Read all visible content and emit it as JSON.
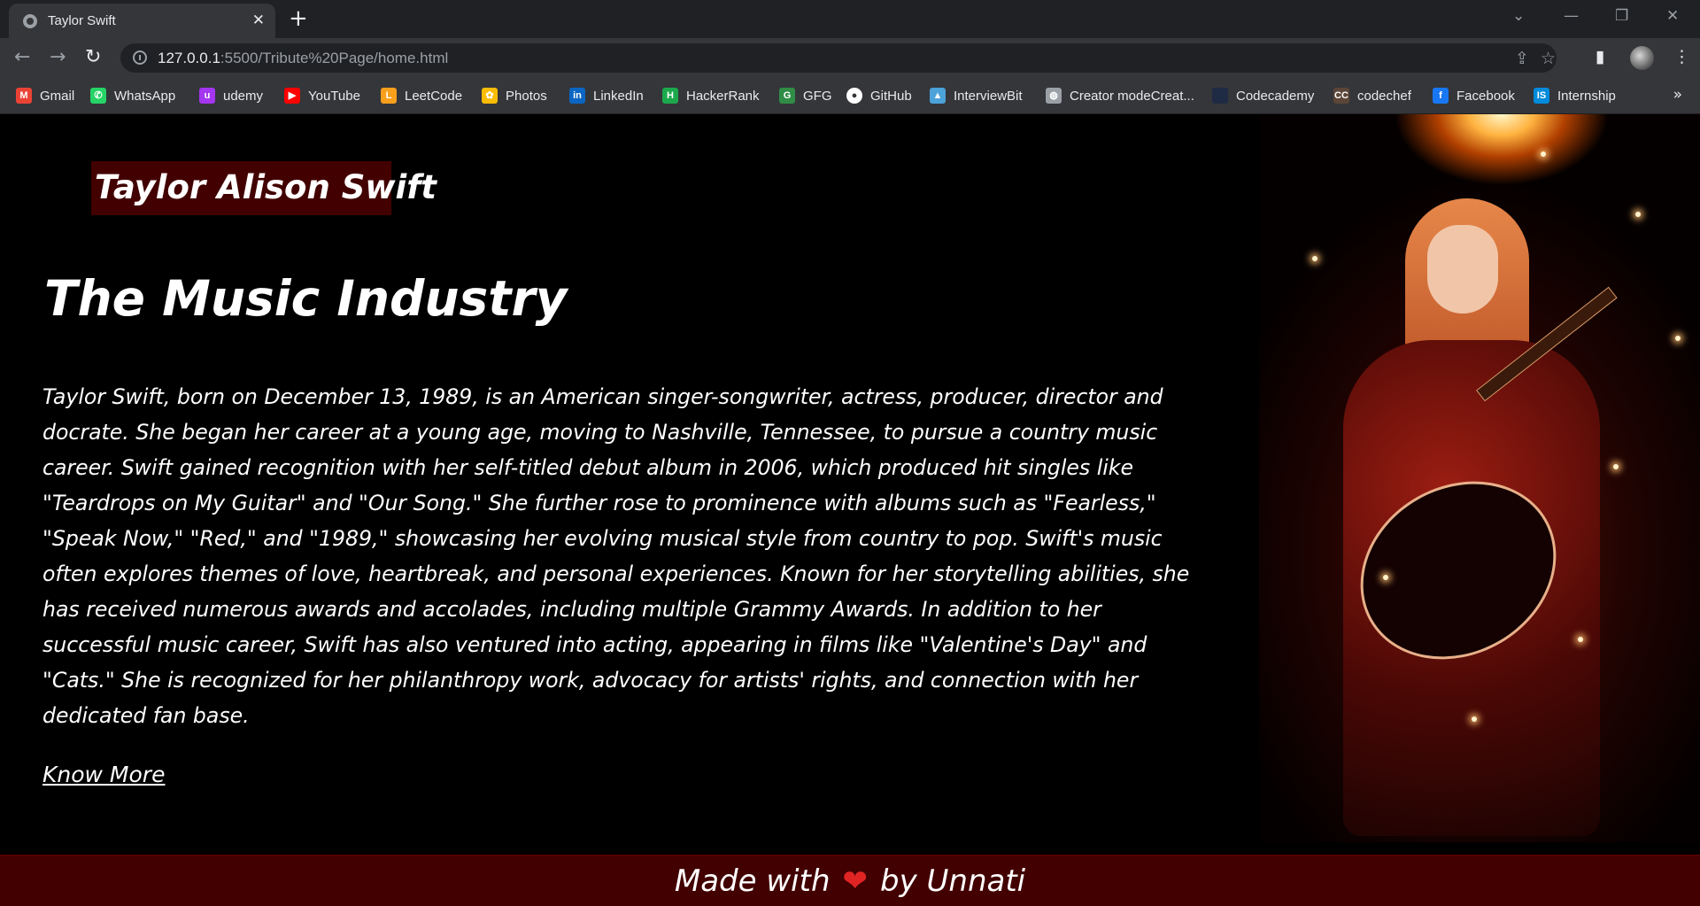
{
  "browser": {
    "tab_title": "Taylor Swift",
    "url_host": "127.0.0.1",
    "url_rest": ":5500/Tribute%20Page/home.html",
    "bookmarks": [
      {
        "label": "Gmail",
        "icon": "gmail-icon",
        "color": "#ea4335",
        "glyph": "M"
      },
      {
        "label": "WhatsApp",
        "icon": "whatsapp-icon",
        "color": "#25d366",
        "glyph": "✆"
      },
      {
        "label": "udemy",
        "icon": "udemy-icon",
        "color": "#a435f0",
        "glyph": "u"
      },
      {
        "label": "YouTube",
        "icon": "youtube-icon",
        "color": "#ff0000",
        "glyph": "▶"
      },
      {
        "label": "LeetCode",
        "icon": "leetcode-icon",
        "color": "#f89f1b",
        "glyph": "L"
      },
      {
        "label": "Photos",
        "icon": "photos-icon",
        "color": "#fbbc04",
        "glyph": "✿"
      },
      {
        "label": "LinkedIn",
        "icon": "linkedin-icon",
        "color": "#0a66c2",
        "glyph": "in"
      },
      {
        "label": "HackerRank",
        "icon": "hackerrank-icon",
        "color": "#1ba94c",
        "glyph": "H"
      },
      {
        "label": "GFG",
        "icon": "gfg-icon",
        "color": "#2f8d46",
        "glyph": "G"
      },
      {
        "label": "GitHub",
        "icon": "github-icon",
        "color": "#ffffff",
        "glyph": "●"
      },
      {
        "label": "InterviewBit",
        "icon": "interviewbit-icon",
        "color": "#4ca2d9",
        "glyph": "▲"
      },
      {
        "label": "Creator modeCreat...",
        "icon": "globe-icon",
        "color": "#9aa0a6",
        "glyph": "◍"
      },
      {
        "label": "Codecademy",
        "icon": "codecademy-icon",
        "color": "#1f2a44",
        "glyph": ""
      },
      {
        "label": "codechef",
        "icon": "codechef-icon",
        "color": "#5b4638",
        "glyph": "CC"
      },
      {
        "label": "Facebook",
        "icon": "facebook-icon",
        "color": "#1877f2",
        "glyph": "f"
      },
      {
        "label": "Internship",
        "icon": "internshala-icon",
        "color": "#008bdc",
        "glyph": "IS"
      }
    ]
  },
  "page": {
    "name_badge": "Taylor Alison Swift",
    "heading": "The Music Industry",
    "bio": "Taylor Swift, born on December 13, 1989, is an American singer-songwriter, actress, producer, director and docrate. She began her career at a young age, moving to Nashville, Tennessee, to pursue a country music career. Swift gained recognition with her self-titled debut album in 2006, which produced hit singles like \"Teardrops on My Guitar\" and \"Our Song.\" She further rose to prominence with albums such as \"Fearless,\" \"Speak Now,\" \"Red,\" and \"1989,\" showcasing her evolving musical style from country to pop. Swift's music often explores themes of love, heartbreak, and personal experiences. Known for her storytelling abilities, she has received numerous awards and accolades, including multiple Grammy Awards. In addition to her successful music career, Swift has also ventured into acting, appearing in films like \"Valentine's Day\" and \"Cats.\" She is recognized for her philanthropy work, advocacy for artists' rights, and connection with her dedicated fan base.",
    "know_more": "Know More",
    "footer_before": "Made with",
    "footer_after": "by Unnati",
    "colors": {
      "badge_bg": "#420000",
      "footer_bg": "#420000",
      "heart": "#e02424"
    }
  }
}
